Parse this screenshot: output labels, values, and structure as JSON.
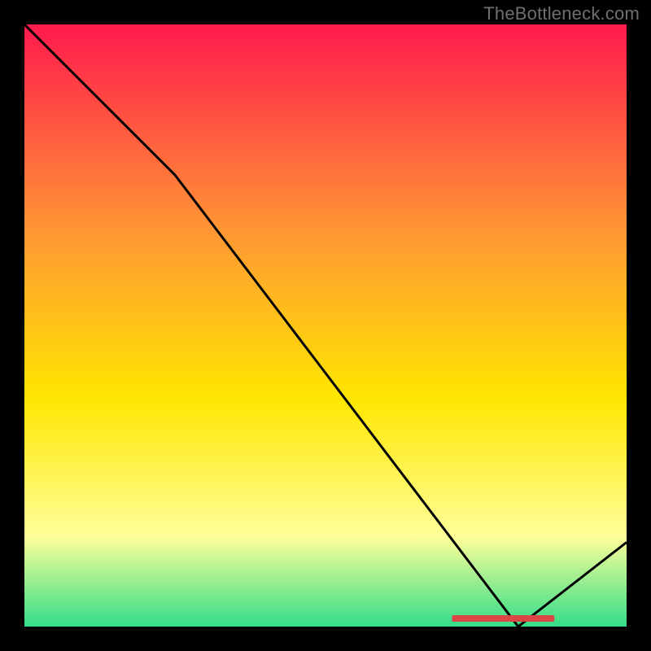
{
  "attribution": "TheBottleneck.com",
  "chart_data": {
    "type": "line",
    "title": "",
    "xlabel": "",
    "ylabel": "",
    "xlim": [
      0,
      100
    ],
    "ylim": [
      0,
      100
    ],
    "series": [
      {
        "name": "curve",
        "x": [
          0,
          25,
          82,
          100
        ],
        "y": [
          100,
          75,
          0,
          14
        ]
      }
    ],
    "marker_range_x": [
      71,
      88
    ],
    "background_gradient": {
      "top": "#ff1a4d",
      "upper_mid": "#ff9933",
      "mid": "#ffe600",
      "lower_mid": "#ffff99",
      "bottom": "#33dd88"
    }
  }
}
